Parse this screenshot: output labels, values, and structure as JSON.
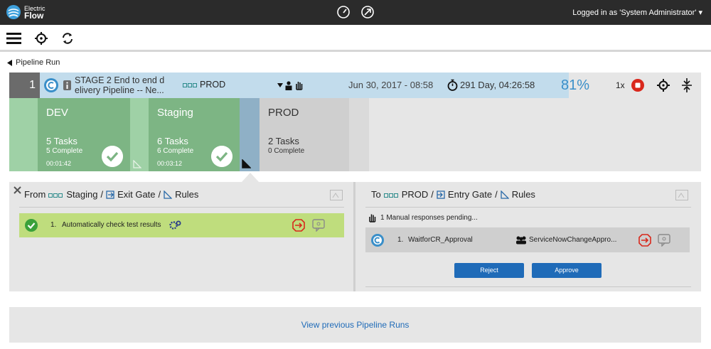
{
  "topbar": {
    "logo_line1": "Electric",
    "logo_line2": "Flow",
    "user": "Logged in as 'System Administrator' ▾"
  },
  "breadcrumb": {
    "label": "Pipeline Run"
  },
  "run": {
    "number": "1",
    "name_line1": "STAGE 2 End to end d",
    "name_line2": "elivery Pipeline -- Ne...",
    "env": "PROD",
    "date": "Jun 30, 2017 - 08:58",
    "elapsed": "291 Day, 04:26:58",
    "progress": "81%",
    "speed": "1x"
  },
  "stages": [
    {
      "name": "DEV",
      "tasks": "5 Tasks",
      "complete": "5 Complete",
      "duration": "00:01:42"
    },
    {
      "name": "Staging",
      "tasks": "6 Tasks",
      "complete": "6 Complete",
      "duration": "00:03:12"
    },
    {
      "name": "PROD",
      "tasks": "2 Tasks",
      "complete": "0 Complete",
      "duration": ""
    }
  ],
  "exit_gate": {
    "from": "From",
    "stage": "Staging",
    "gate": "Exit Gate",
    "rules": "Rules",
    "rule_number": "1.",
    "rule_text": "Automatically check test results"
  },
  "entry_gate": {
    "to": "To",
    "stage": "PROD",
    "gate": "Entry Gate",
    "rules": "Rules",
    "pending": "1 Manual responses pending...",
    "task_number": "1.",
    "task_name": "WaitforCR_Approval",
    "assignee": "ServiceNowChangeAppro...",
    "reject": "Reject",
    "approve": "Approve"
  },
  "footer": {
    "link": "View previous Pipeline Runs"
  },
  "colors": {
    "topbar": "#2b2b2b",
    "stage_green": "#7db584",
    "stage_green_light": "#9fd1a6",
    "prod_grey": "#cfcfcf",
    "progress_blue": "#c2dcec",
    "rule_ok": "#bfdd7d",
    "button_blue": "#1f6bb8",
    "reject_red": "#d9281c"
  }
}
